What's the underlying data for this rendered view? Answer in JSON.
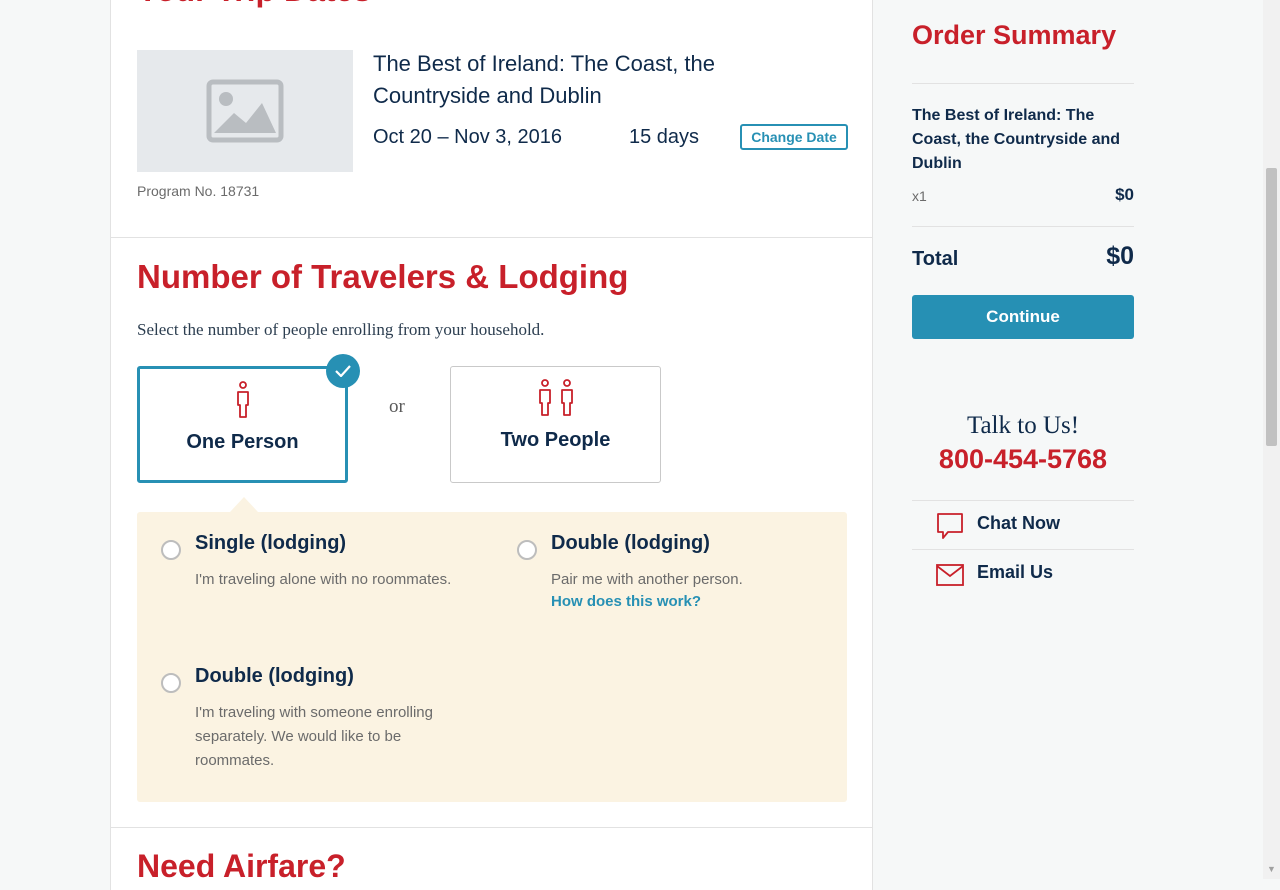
{
  "trip_section": {
    "heading": "Your Trip Dates",
    "trip_title": "The Best of Ireland: The Coast, the Countryside and Dublin",
    "dates": "Oct 20 – Nov 3, 2016",
    "duration": "15 days",
    "change_date_label": "Change Date",
    "program_no": "Program No. 18731",
    "thumbnail_icon": "image-placeholder-icon"
  },
  "travelers_section": {
    "heading": "Number of Travelers & Lodging",
    "subtitle": "Select the number of people enrolling from your household.",
    "or_label": "or",
    "options": [
      {
        "label": "One Person",
        "icon": "person-icon",
        "selected": true
      },
      {
        "label": "Two People",
        "icon": "two-people-icon",
        "selected": false
      }
    ]
  },
  "lodging": {
    "options": [
      {
        "title": "Single (lodging)",
        "description": "I'm traveling alone with no roommates."
      },
      {
        "title": "Double (lodging)",
        "description": "Pair me with another person.",
        "link": "How does this work?"
      },
      {
        "title": "Double (lodging)",
        "description": "I'm traveling with someone enrolling separately. We would like to be roommates."
      }
    ]
  },
  "airfare_section": {
    "heading": "Need Airfare?"
  },
  "order_summary": {
    "title": "Order Summary",
    "item_name": "The Best of Ireland: The Coast, the Countryside and Dublin",
    "quantity": "x1",
    "item_price": "$0",
    "total_label": "Total",
    "total_value": "$0",
    "continue_label": "Continue"
  },
  "contact": {
    "title": "Talk to Us!",
    "phone": "800-454-5768",
    "chat_label": "Chat Now",
    "email_label": "Email Us"
  },
  "colors": {
    "brand_red": "#c8202a",
    "accent_blue": "#2790b4",
    "navy_text": "#0f2a4a",
    "lodging_panel_bg": "#fbf3e2"
  }
}
